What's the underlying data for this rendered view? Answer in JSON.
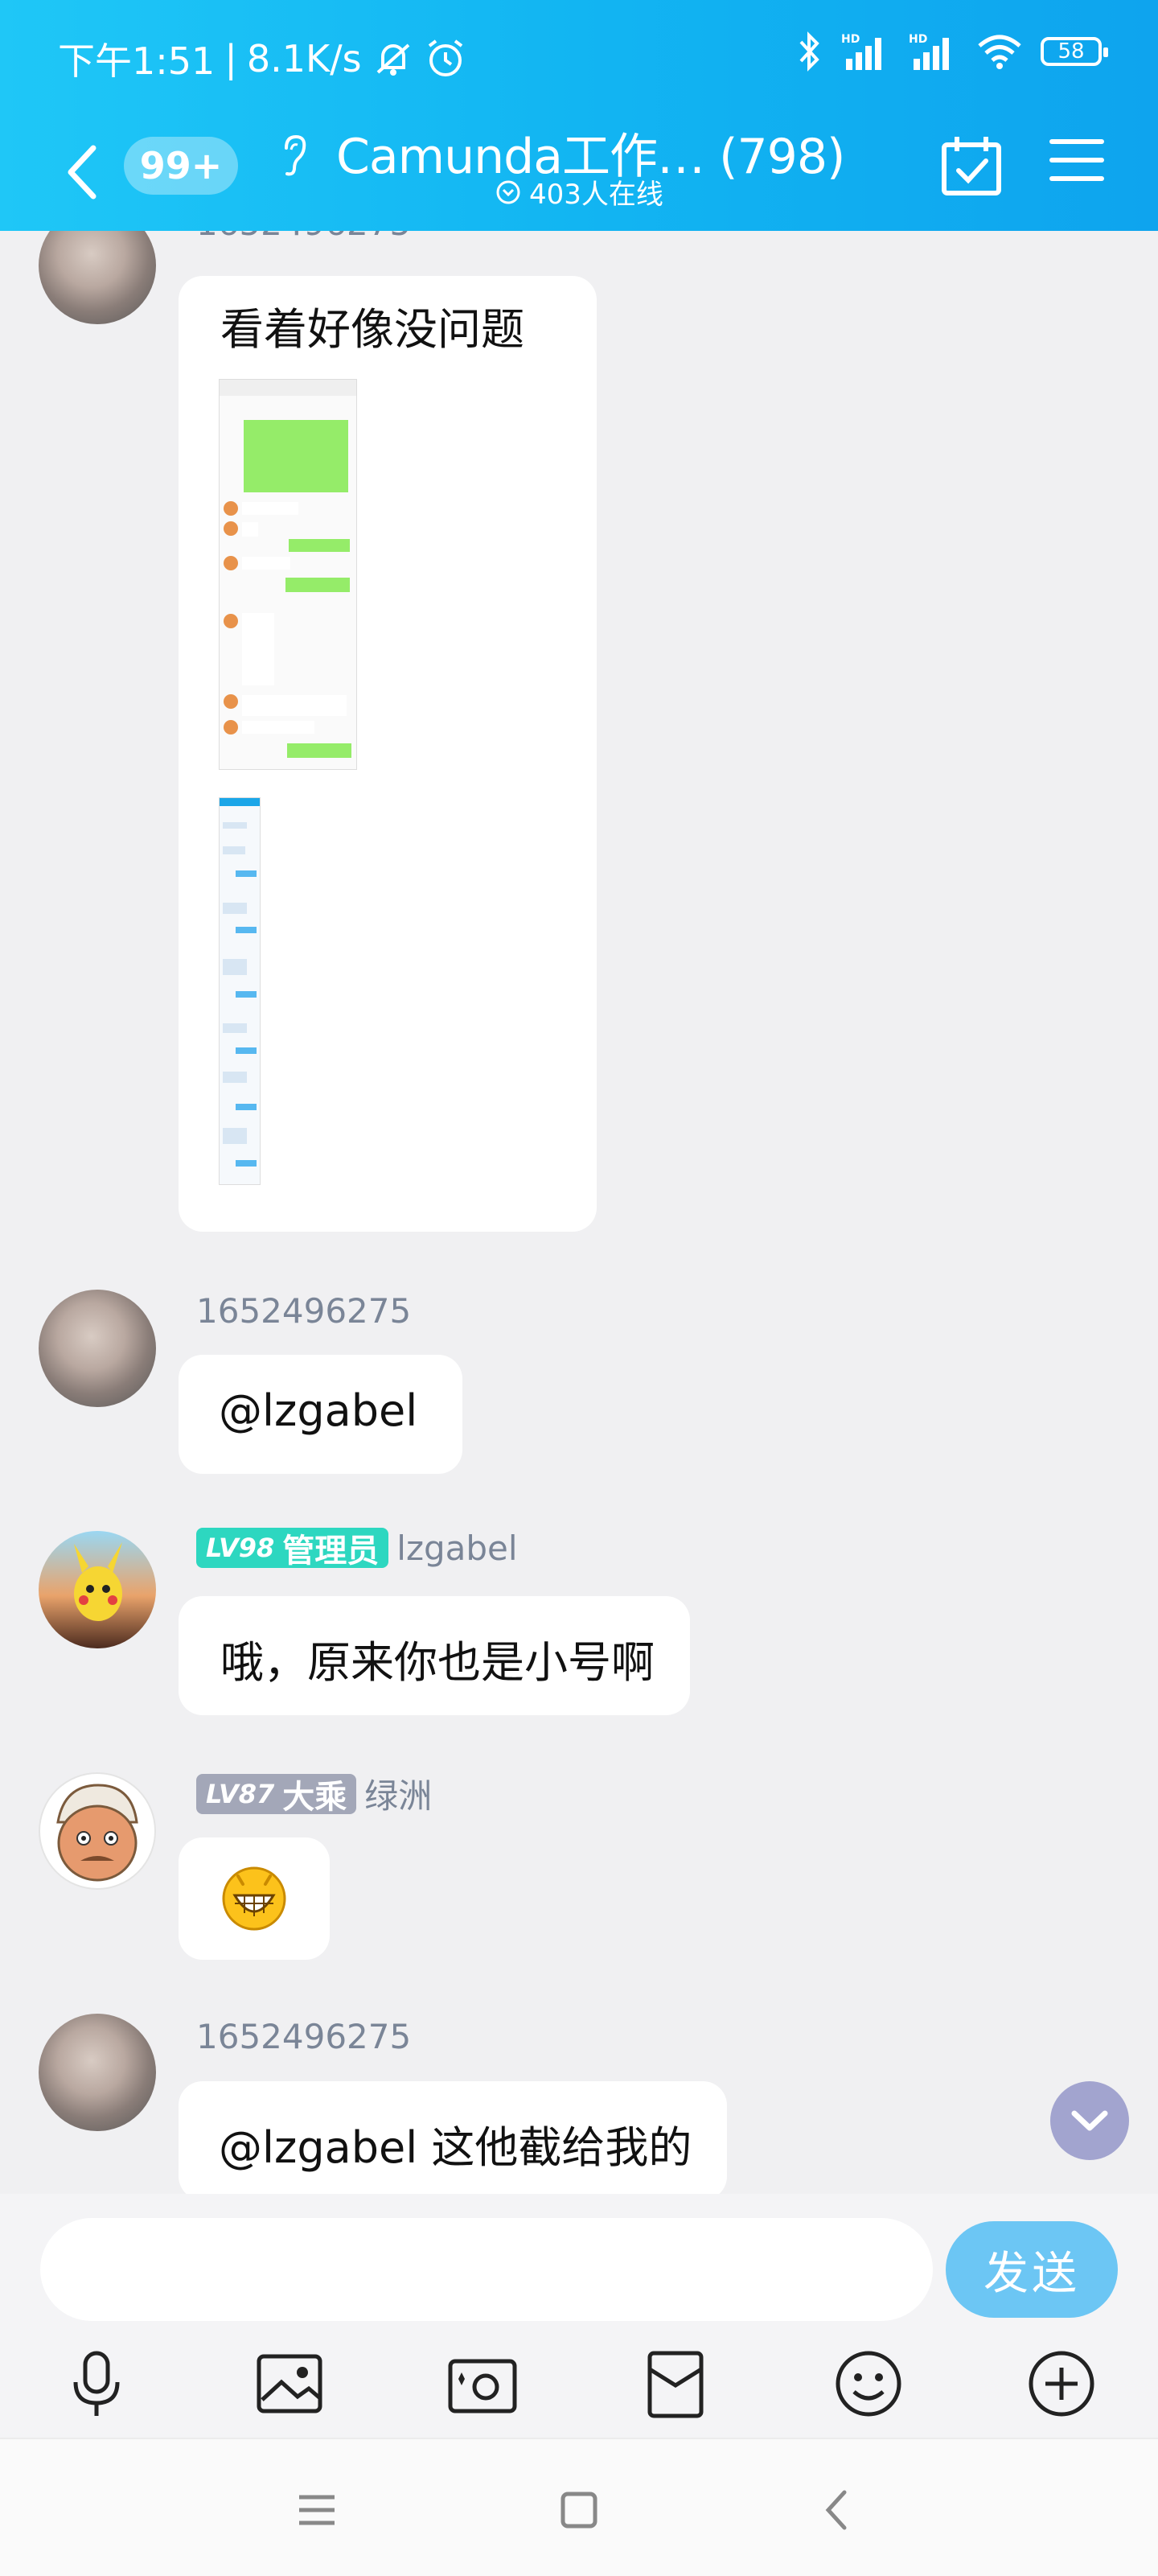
{
  "status_bar": {
    "time": "下午1:51",
    "net_speed": "8.1K/s",
    "battery": "58"
  },
  "header": {
    "unread_badge": "99+",
    "group_title": "Camunda工作… (798)",
    "online_count": "403人在线"
  },
  "messages": [
    {
      "sender": "1652496275",
      "text": "看着好像没问题",
      "has_images": true
    },
    {
      "sender": "1652496275",
      "text": "@lzgabel"
    },
    {
      "level": "LV98",
      "role": "管理员",
      "sender": "lzgabel",
      "text": "哦，原来你也是小号啊"
    },
    {
      "level": "LV87",
      "role": "大乘",
      "sender": "绿洲",
      "emoji": "grinning-face"
    },
    {
      "sender": "1652496275",
      "text": "@lzgabel 这他截给我的"
    }
  ],
  "composer": {
    "send_label": "发送"
  },
  "colors": {
    "header": "#12b5f2",
    "admin_badge": "#2dd7c0",
    "dacheng_badge": "#a3a7b8",
    "send_button": "#6cc6f4"
  },
  "icons": [
    "voice-icon",
    "image-icon",
    "camera-icon",
    "red-packet-icon",
    "emoji-icon",
    "add-icon"
  ]
}
